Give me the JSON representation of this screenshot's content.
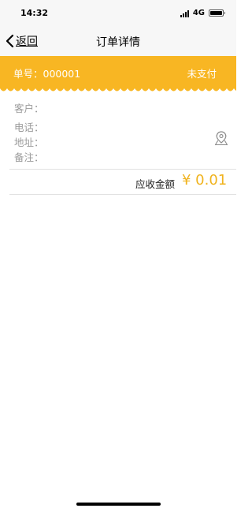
{
  "status_bar": {
    "time": "14:32",
    "network": "4G",
    "signal_icon": "cellular-signal-icon",
    "battery_icon": "battery-icon"
  },
  "nav": {
    "back_label": "返回",
    "back_icon": "chevron-left-icon",
    "title": "订单详情"
  },
  "order": {
    "number_label": "单号：000001",
    "status": "未支付",
    "banner_color": "#F8B623"
  },
  "fields": {
    "customer": "客户：",
    "phone": "电话：",
    "address": "地址：",
    "remark": "备注：",
    "location_icon": "map-pin-icon"
  },
  "total": {
    "label": "应收金额",
    "amount": "¥ 0.01",
    "accent_color": "#F0B31E"
  }
}
